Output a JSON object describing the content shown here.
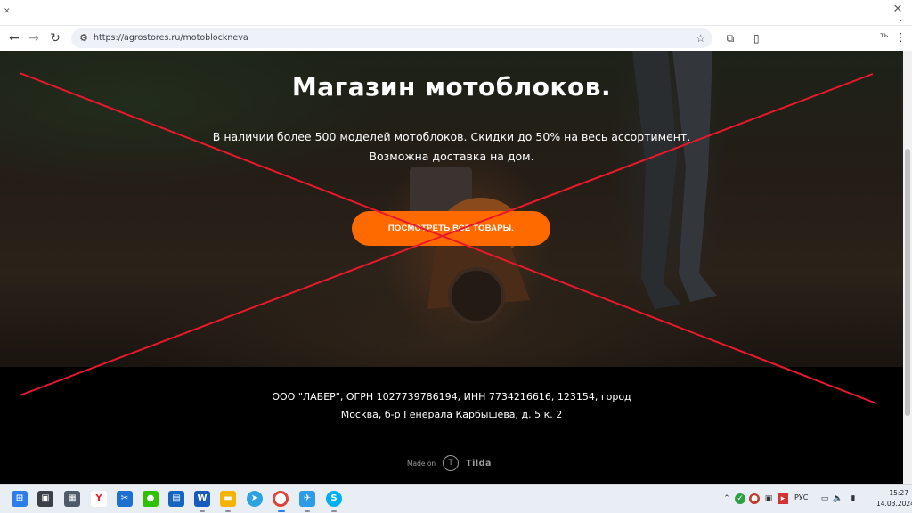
{
  "browser": {
    "url": "https://agrostores.ru/motoblockneva",
    "profile_text": "ть"
  },
  "hero": {
    "title": "Магазин мотоблоков.",
    "text_line1": "В наличии более 500 моделей мотоблоков. Скидки до 50% на весь ассортимент.",
    "text_line2": "Возможна доставка на дом.",
    "cta_label": "ПОСМОТРЕТЬ ВСЕ ТОВАРЫ."
  },
  "footer": {
    "line1": "ООО \"ЛАБЕР\", ОГРН 1027739786194, ИНН 7734216616, 123154, город",
    "line2": "Москва, б-р Генерала Карбышева, д. 5 к. 2",
    "made_on": "Made on",
    "tilda": "Tilda"
  },
  "taskbar": {
    "lang": "РУС",
    "time": "15:27",
    "date": "14.03.2024"
  },
  "colors": {
    "accent": "#ff6a00",
    "cross": "#e8192c"
  }
}
